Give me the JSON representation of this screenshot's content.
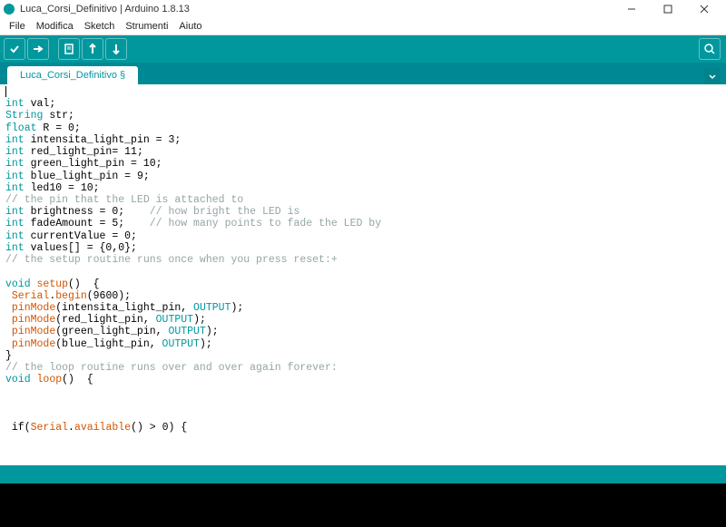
{
  "window": {
    "title": "Luca_Corsi_Definitivo | Arduino 1.8.13"
  },
  "menu": {
    "items": [
      "File",
      "Modifica",
      "Sketch",
      "Strumenti",
      "Aiuto"
    ]
  },
  "toolbar": {
    "verify": "Verify",
    "upload": "Upload",
    "new": "New",
    "open": "Open",
    "save": "Save",
    "serial": "Serial Monitor"
  },
  "tab": {
    "name": "Luca_Corsi_Definitivo §"
  },
  "code": {
    "l1a": "int",
    "l1b": " val;",
    "l2a": "String",
    "l2b": " str;",
    "l3a": "float",
    "l3b": " R = 0;",
    "l4a": "int",
    "l4b": " intensita_light_pin = 3;",
    "l5a": "int",
    "l5b": " red_light_pin= 11;",
    "l6a": "int",
    "l6b": " green_light_pin = 10;",
    "l7a": "int",
    "l7b": " blue_light_pin = 9;",
    "l8a": "int",
    "l8b": " led10 = 10;",
    "l9": "// the pin that the LED is attached to",
    "l10a": "int",
    "l10b": " brightness = 0;    ",
    "l10c": "// how bright the LED is",
    "l11a": "int",
    "l11b": " fadeAmount = 5;    ",
    "l11c": "// how many points to fade the LED by",
    "l12a": "int",
    "l12b": " currentValue = 0;",
    "l13a": "int",
    "l13b": " values[] = {0,0};",
    "l14": "// the setup routine runs once when you press reset:+",
    "blank": "",
    "l15a": "void",
    "l15b": " ",
    "l15c": "setup",
    "l15d": "()  {",
    "l16a": " ",
    "l16b": "Serial",
    "l16c": ".",
    "l16d": "begin",
    "l16e": "(9600);",
    "l17a": " ",
    "l17b": "pinMode",
    "l17c": "(intensita_light_pin, ",
    "l17d": "OUTPUT",
    "l17e": ");",
    "l18a": " ",
    "l18b": "pinMode",
    "l18c": "(red_light_pin, ",
    "l18d": "OUTPUT",
    "l18e": ");",
    "l19a": " ",
    "l19b": "pinMode",
    "l19c": "(green_light_pin, ",
    "l19d": "OUTPUT",
    "l19e": ");",
    "l20a": " ",
    "l20b": "pinMode",
    "l20c": "(blue_light_pin, ",
    "l20d": "OUTPUT",
    "l20e": ");",
    "l21": "}",
    "l22": "// the loop routine runs over and over again forever:",
    "l23a": "void",
    "l23b": " ",
    "l23c": "loop",
    "l23d": "()  {",
    "l24a": " if(",
    "l24b": "Serial",
    "l24c": ".",
    "l24d": "available",
    "l24e": "() > 0) {"
  }
}
